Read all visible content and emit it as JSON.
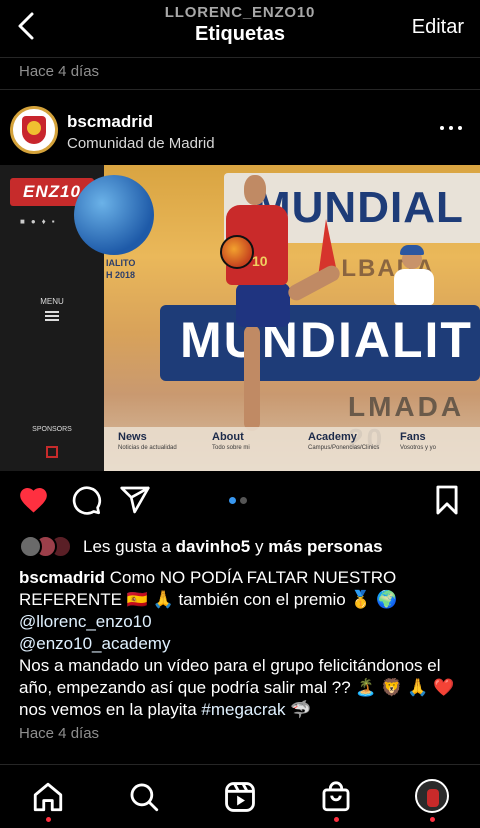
{
  "header": {
    "username": "LLORENC_ENZO10",
    "title": "Etiquetas",
    "edit_label": "Editar"
  },
  "previous_post": {
    "time": "Hace 4 días"
  },
  "post": {
    "username": "bscmadrid",
    "location": "Comunidad de Madrid",
    "image": {
      "logo_text": "ENZ10",
      "menu_label": "MENU",
      "sponsors_label": "SPONSORS",
      "banner_top": "MUNDIAL",
      "banner_mid": "ALBADA",
      "banner_main": "MUNDIALIT",
      "banner_low": "LMADA 20",
      "side_caption": "IALITO\nH 2018",
      "shirt_number": "10",
      "nav": [
        {
          "title": "News",
          "subtitle": "Noticias de actualidad"
        },
        {
          "title": "About",
          "subtitle": "Todo sobre mi"
        },
        {
          "title": "Academy",
          "subtitle": "Campus/Ponencias/Clinics"
        },
        {
          "title": "Fans",
          "subtitle": "Vosotros y yo"
        }
      ]
    },
    "carousel": {
      "count": 2,
      "active": 1,
      "active_color": "#3897f0",
      "inactive_color": "#555555"
    },
    "likes": {
      "prefix": "Les gusta a ",
      "user": "davinho5",
      "connector": " y ",
      "rest": "más personas"
    },
    "caption": {
      "username": "bscmadrid",
      "line1": " Como NO PODÍA FALTAR NUESTRO REFERENTE 🇪🇸 🙏 también con el premio 🥇 🌍",
      "mention1": "@llorenc_enzo10",
      "mention2": "@enzo10_academy",
      "line2": "Nos a mandado un vídeo para el grupo felicitándonos el año, empezando así que podría salir mal ?? 🏝️ 🦁 🙏 ❤️  nos vemos en la playita ",
      "hashtag": "#megacrak",
      "line3": " 🦈"
    },
    "time": "Hace 4 días"
  },
  "colors": {
    "like": "#ff3040",
    "background": "#000000",
    "accent": "#3897f0"
  },
  "icons": [
    "back-chevron-icon",
    "more-dots-icon",
    "heart-filled-icon",
    "comment-icon",
    "share-icon",
    "bookmark-icon",
    "home-icon",
    "search-icon",
    "reels-icon",
    "shop-icon",
    "profile-avatar"
  ]
}
